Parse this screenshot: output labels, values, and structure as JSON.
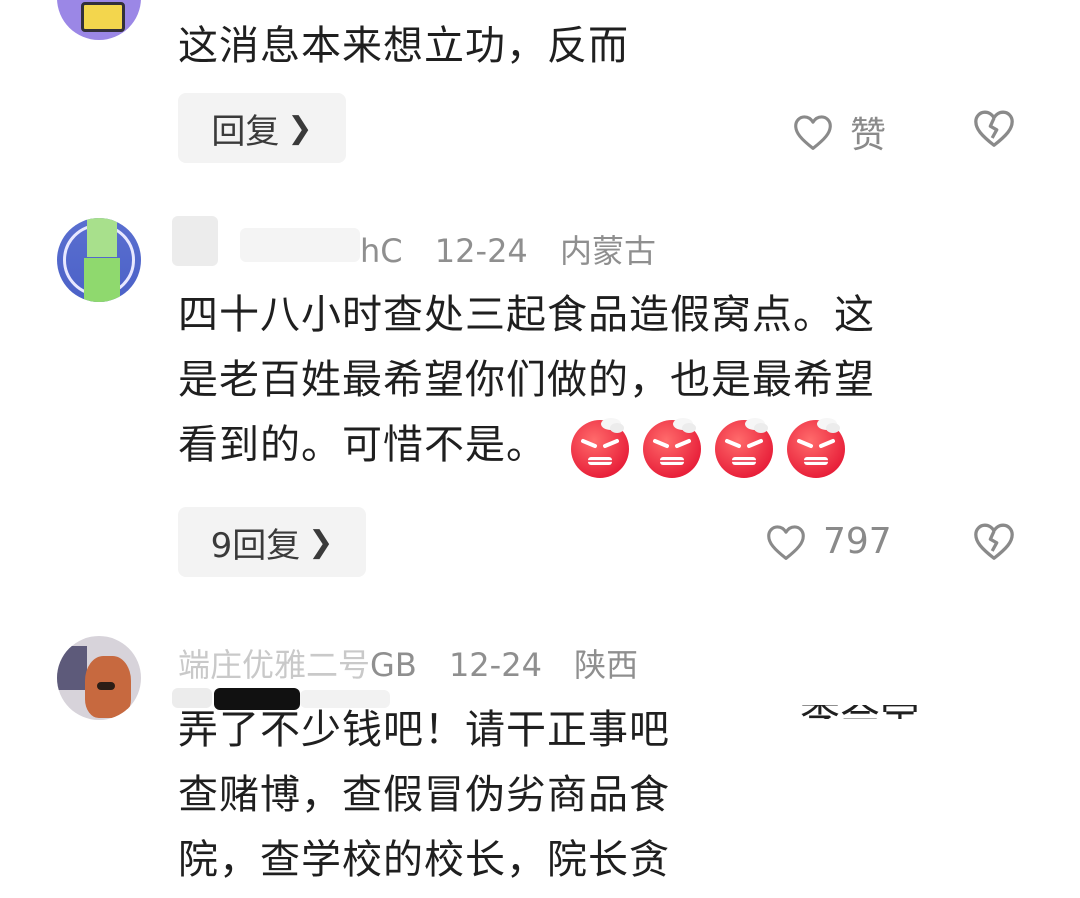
{
  "comments": [
    {
      "text_lines": [
        "这消息本来想立功，反而"
      ],
      "reply_label": "回复",
      "like_label": "赞"
    },
    {
      "user_suffix": "hC",
      "date": "12-24",
      "location": "内蒙古",
      "text_lines": [
        "四十八小时查处三起食品造假窝点。这",
        "是老百姓最希望你们做的，也是最希望",
        "看到的。可惜不是。"
      ],
      "emoji_name": "angry-face-emoji",
      "emoji_count": 4,
      "reply_label": "9回复",
      "like_count": "797"
    },
    {
      "user_prefix": "端庄优雅二号",
      "user_suffix": "GB",
      "date": "12-24",
      "location": "陕西",
      "text_lines": [
        "弄了不少钱吧！请干正事吧",
        "查赌博，查假冒伪劣商品食",
        "院，查学校的校长，院长贪"
      ],
      "clipped_tail": "李会宝"
    }
  ],
  "colors": {
    "text": "#1f1f1f",
    "meta": "#8f8f8f",
    "button_bg": "#f3f3f3",
    "icon": "#8a8a8a",
    "emoji_red": "#e8203a"
  },
  "icons": {
    "like": "heart-outline-icon",
    "dislike": "broken-heart-icon",
    "reply_arrow": "chevron-right-icon"
  }
}
